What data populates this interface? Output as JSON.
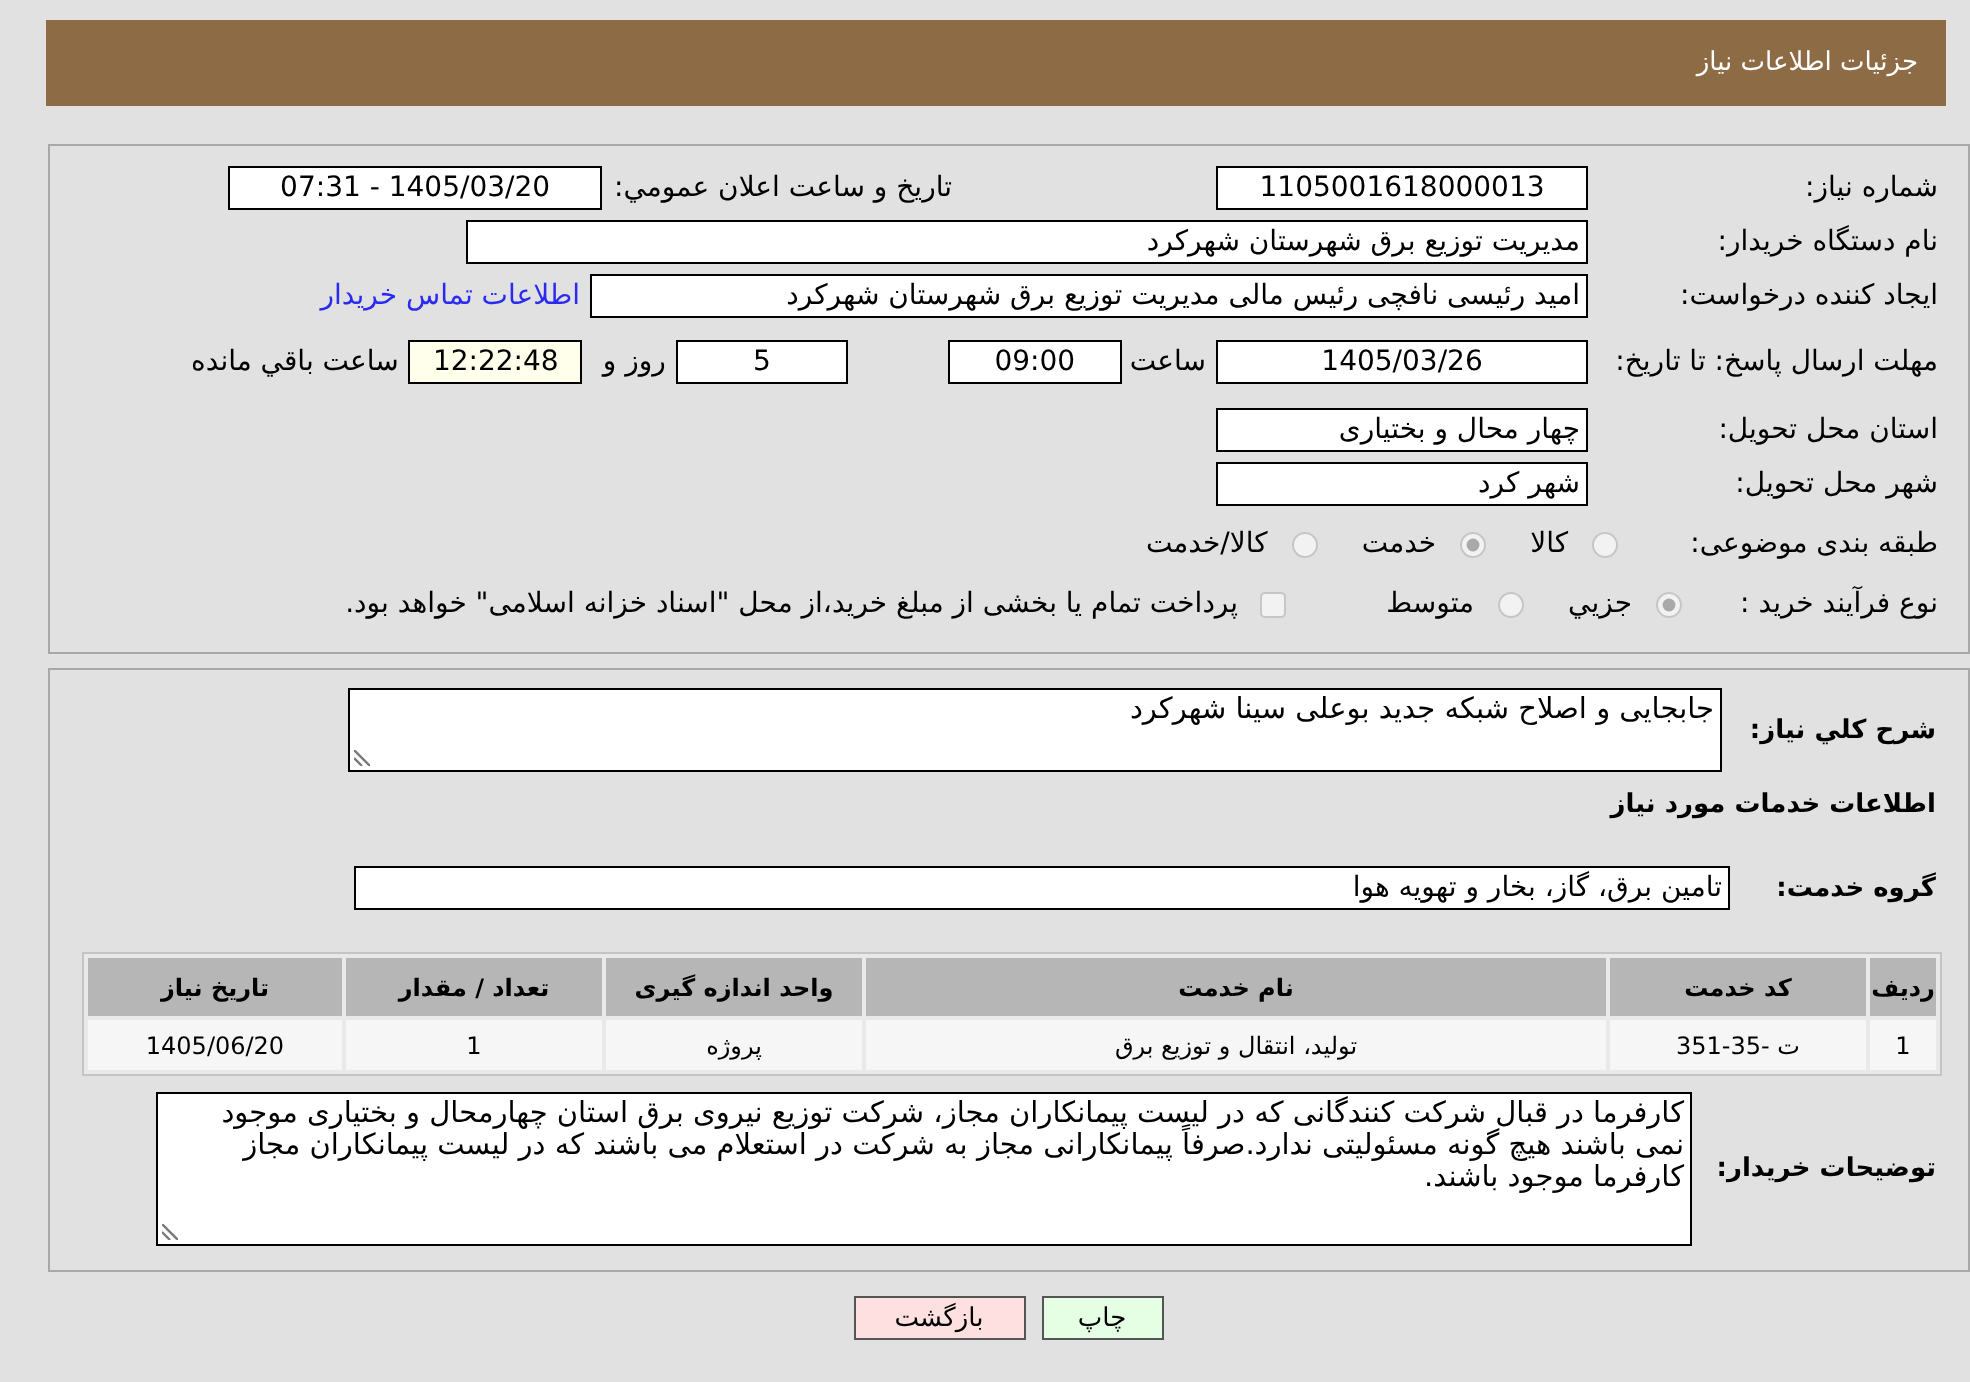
{
  "header": {
    "title": "جزئیات اطلاعات نیاز"
  },
  "details": {
    "need_number": {
      "label": "شماره نیاز:",
      "value": "1105001618000013"
    },
    "announcement": {
      "label": "تاریخ و ساعت اعلان عمومي:",
      "value": "1405/03/20 - 07:31"
    },
    "buyer_org": {
      "label": "نام دستگاه خریدار:",
      "value": "مدیریت توزیع برق شهرستان شهرکرد"
    },
    "requester": {
      "label": "ایجاد کننده درخواست:",
      "value": "امید رئیسی نافچی رئیس مالی مدیریت توزیع برق شهرستان شهرکرد",
      "contact_link": "اطلاعات تماس خریدار"
    },
    "deadline": {
      "label": "مهلت ارسال پاسخ: تا تاریخ:",
      "date": "1405/03/26",
      "time_label": "ساعت",
      "time": "09:00",
      "days": "5",
      "days_label": "روز و",
      "remaining": "12:22:48",
      "remaining_label": "ساعت باقي مانده"
    },
    "province": {
      "label": "استان محل تحویل:",
      "value": "چهار محال و بختیاری"
    },
    "city": {
      "label": "شهر محل تحویل:",
      "value": "شهر کرد"
    },
    "category": {
      "label": "طبقه بندی موضوعی:",
      "options": [
        {
          "label": "کالا",
          "selected": false,
          "disabled": true
        },
        {
          "label": "خدمت",
          "selected": true,
          "disabled": true
        },
        {
          "label": "کالا/خدمت",
          "selected": false,
          "disabled": true
        }
      ]
    },
    "purchase_process": {
      "label": "نوع فرآیند خرید :",
      "options": [
        {
          "label": "جزيي",
          "selected": true,
          "disabled": true
        },
        {
          "label": "متوسط",
          "selected": false,
          "disabled": true
        }
      ],
      "treasury_option": {
        "label": "پرداخت تمام یا بخشی از مبلغ خرید،از محل \"اسناد خزانه اسلامی\" خواهد بود.",
        "checked": false,
        "disabled": true
      }
    }
  },
  "description": {
    "label": "شرح کلي نیاز:",
    "value": "جابجایی و اصلاح شبکه جدید بوعلی سینا شهرکرد"
  },
  "services": {
    "title": "اطلاعات خدمات مورد نیاز",
    "group_label": "گروه خدمت:",
    "group_value": "تامین برق، گاز، بخار و تهویه هوا"
  },
  "table": {
    "columns": [
      "ردیف",
      "کد خدمت",
      "نام خدمت",
      "واحد اندازه گیری",
      "تعداد / مقدار",
      "تاریخ نیاز"
    ],
    "rows": [
      [
        "1",
        "ت -35-351",
        "تولید، انتقال و توزیع برق",
        "پروژه",
        "1",
        "1405/06/20"
      ]
    ]
  },
  "notes": {
    "label": "توضیحات خریدار:",
    "value": "کارفرما در قبال شرکت کنندگانی که در لیست پیمانکاران مجاز، شرکت توزیع نیروی برق استان چهارمحال و بختیاری موجود نمی باشند هیچ گونه مسئولیتی ندارد.صرفاً پیمانکارانی مجاز به شرکت در استعلام می باشند که در لیست پیمانکاران مجاز کارفرما موجود باشند."
  },
  "buttons": [
    {
      "label": "چاپ",
      "kind": "print"
    },
    {
      "label": "بازگشت",
      "kind": "back"
    }
  ]
}
